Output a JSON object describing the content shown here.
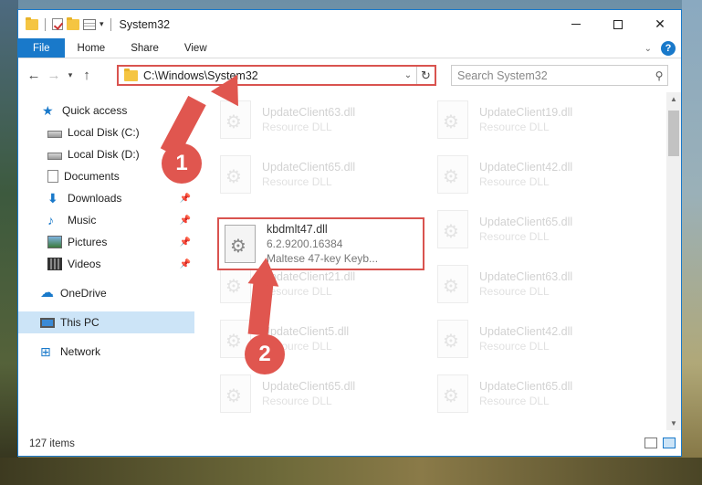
{
  "window": {
    "title": "System32",
    "controls": {
      "minimize": "—",
      "maximize": "□",
      "close": "✕"
    }
  },
  "ribbon": {
    "tabs": [
      "File",
      "Home",
      "Share",
      "View"
    ],
    "help": "?"
  },
  "address": {
    "path": "C:\\Windows\\System32",
    "search_placeholder": "Search System32"
  },
  "sidebar": {
    "items": [
      {
        "label": "Quick access",
        "icon": "star-icon",
        "pinned": false
      },
      {
        "label": "Local Disk (C:)",
        "icon": "drive-icon",
        "pinned": true
      },
      {
        "label": "Local Disk (D:)",
        "icon": "drive-icon",
        "pinned": false
      },
      {
        "label": "Documents",
        "icon": "documents-icon",
        "pinned": true
      },
      {
        "label": "Downloads",
        "icon": "downloads-icon",
        "pinned": true
      },
      {
        "label": "Music",
        "icon": "music-icon",
        "pinned": true
      },
      {
        "label": "Pictures",
        "icon": "pictures-icon",
        "pinned": true
      },
      {
        "label": "Videos",
        "icon": "videos-icon",
        "pinned": true
      },
      {
        "label": "OneDrive",
        "icon": "onedrive-icon",
        "pinned": false
      },
      {
        "label": "This PC",
        "icon": "this-pc-icon",
        "pinned": false,
        "selected": true
      },
      {
        "label": "Network",
        "icon": "network-icon",
        "pinned": false
      }
    ]
  },
  "files": {
    "left_column": [
      {
        "name": "UpdateClient63.dll",
        "desc": "Resource DLL"
      },
      {
        "name": "UpdateClient65.dll",
        "desc": "Resource DLL"
      },
      {
        "name": "UpdateClient21.dll",
        "desc": "Resource DLL"
      },
      {
        "name": "UpdateClient5.dll",
        "desc": "Resource DLL"
      },
      {
        "name": "UpdateClient65.dll",
        "desc": "Resource DLL"
      }
    ],
    "right_column": [
      {
        "name": "UpdateClient19.dll",
        "desc": "Resource DLL"
      },
      {
        "name": "UpdateClient42.dll",
        "desc": "Resource DLL"
      },
      {
        "name": "UpdateClient65.dll",
        "desc": "Resource DLL"
      },
      {
        "name": "UpdateClient63.dll",
        "desc": "Resource DLL"
      },
      {
        "name": "UpdateClient42.dll",
        "desc": "Resource DLL"
      },
      {
        "name": "UpdateClient65.dll",
        "desc": "Resource DLL"
      }
    ],
    "highlighted": {
      "name": "kbdmlt47.dll",
      "version": "6.2.9200.16384",
      "desc": "Maltese 47-key Keyb..."
    }
  },
  "status": {
    "items": "127 items"
  },
  "annotations": {
    "step1": "1",
    "step2": "2"
  },
  "colors": {
    "accent": "#1979ca",
    "annotation": "#e0564f"
  }
}
